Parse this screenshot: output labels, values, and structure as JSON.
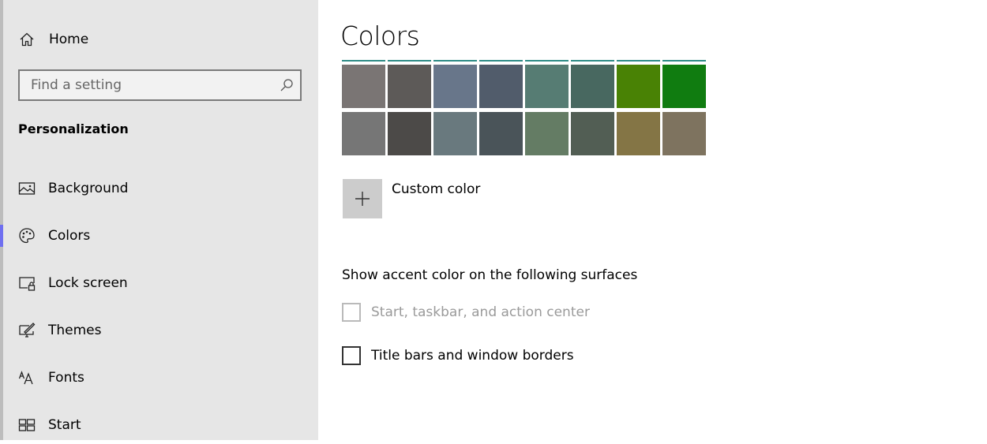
{
  "sidebar": {
    "home_label": "Home",
    "search_placeholder": "Find a setting",
    "section_title": "Personalization",
    "items": [
      {
        "label": "Background",
        "icon": "image-icon"
      },
      {
        "label": "Colors",
        "icon": "palette-icon",
        "selected": true
      },
      {
        "label": "Lock screen",
        "icon": "lock-screen-icon"
      },
      {
        "label": "Themes",
        "icon": "themes-icon"
      },
      {
        "label": "Fonts",
        "icon": "fonts-icon"
      },
      {
        "label": "Start",
        "icon": "start-icon"
      }
    ],
    "accent_color": "#6f6ff0"
  },
  "main": {
    "title": "Colors",
    "swatches": [
      [
        "#7a7574",
        "#5d5a58",
        "#68768a",
        "#515c6b",
        "#567c73",
        "#486860",
        "#498205",
        "#107c10"
      ],
      [
        "#767676",
        "#4c4a48",
        "#69797e",
        "#4a5459",
        "#647c64",
        "#525e54",
        "#847545",
        "#7e735f"
      ]
    ],
    "custom_color_label": "Custom color",
    "surfaces_heading": "Show accent color on the following surfaces",
    "checkboxes": [
      {
        "label": "Start, taskbar, and action center",
        "checked": false,
        "disabled": true
      },
      {
        "label": "Title bars and window borders",
        "checked": false,
        "disabled": false
      }
    ]
  }
}
